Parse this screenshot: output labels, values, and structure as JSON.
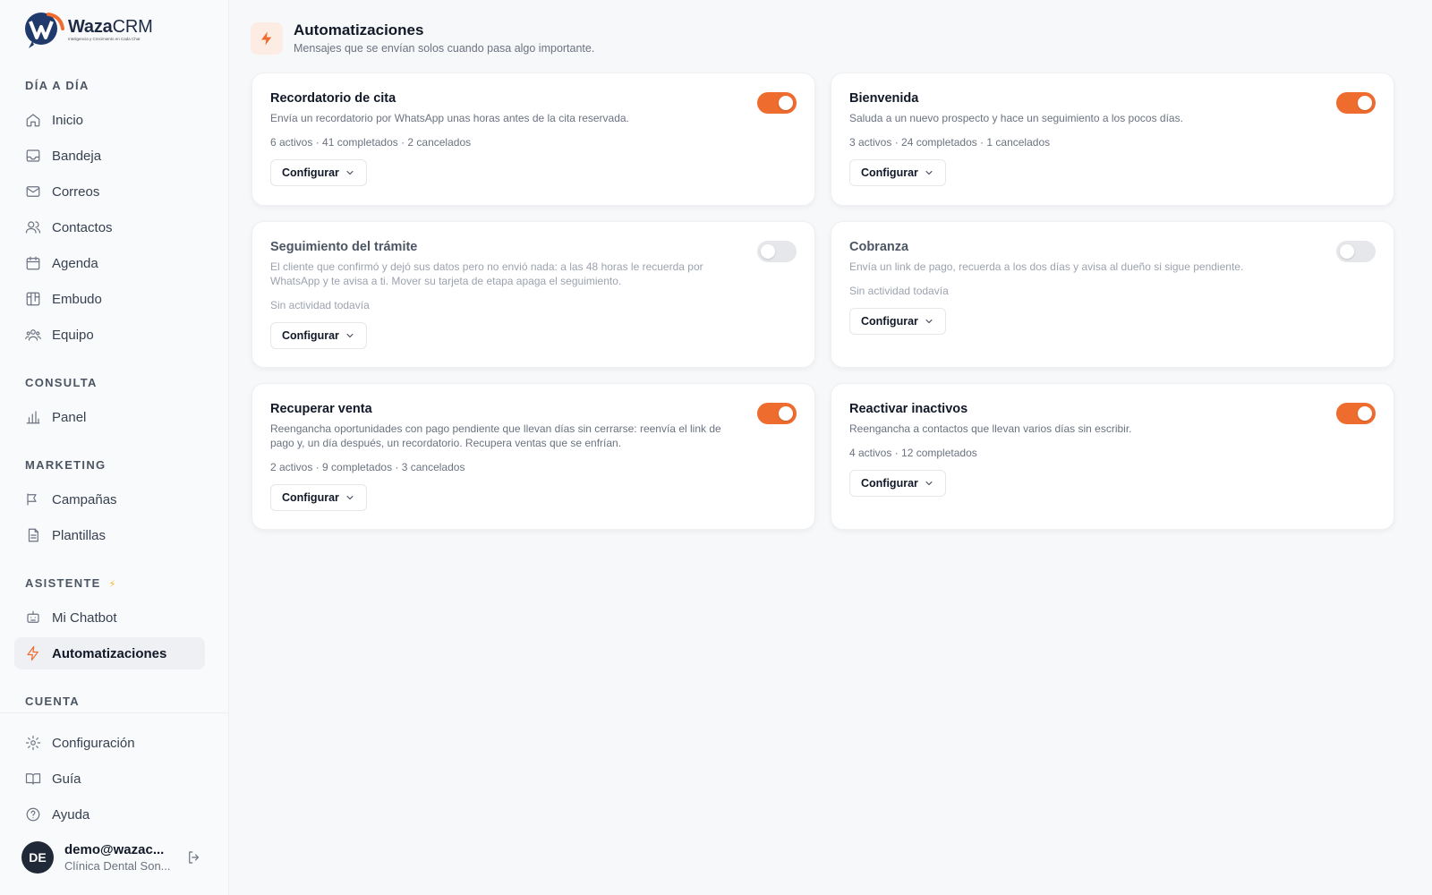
{
  "brand": {
    "name_bold": "Waza",
    "name_light": "CRM",
    "tagline": "Inteligencia y Crecimiento en Cada Chat"
  },
  "sidebar": {
    "sections": [
      {
        "title": "DÍA A DÍA",
        "items": [
          {
            "label": "Inicio",
            "icon": "home-icon"
          },
          {
            "label": "Bandeja",
            "icon": "inbox-icon"
          },
          {
            "label": "Correos",
            "icon": "mail-icon"
          },
          {
            "label": "Contactos",
            "icon": "contacts-icon"
          },
          {
            "label": "Agenda",
            "icon": "calendar-icon"
          },
          {
            "label": "Embudo",
            "icon": "funnel-icon"
          },
          {
            "label": "Equipo",
            "icon": "team-icon"
          }
        ]
      },
      {
        "title": "CONSULTA",
        "items": [
          {
            "label": "Panel",
            "icon": "bar-chart-icon"
          }
        ]
      },
      {
        "title": "MARKETING",
        "items": [
          {
            "label": "Campañas",
            "icon": "megaphone-icon"
          },
          {
            "label": "Plantillas",
            "icon": "file-icon"
          }
        ]
      },
      {
        "title": "ASISTENTE",
        "badge": "⚡",
        "items": [
          {
            "label": "Mi Chatbot",
            "icon": "bot-icon"
          },
          {
            "label": "Automatizaciones",
            "icon": "bolt-icon",
            "active": true
          }
        ]
      },
      {
        "title": "CUENTA",
        "items": [
          {
            "label": "Configuración",
            "icon": "gear-icon"
          },
          {
            "label": "Guía",
            "icon": "book-icon"
          },
          {
            "label": "Ayuda",
            "icon": "help-icon"
          }
        ]
      }
    ],
    "user": {
      "initials": "DE",
      "email": "demo@wazac...",
      "org": "Clínica Dental Son..."
    }
  },
  "header": {
    "title": "Automatizaciones",
    "subtitle": "Mensajes que se envían solos cuando pasa algo importante."
  },
  "cards": [
    {
      "title": "Recordatorio de cita",
      "desc": "Envía un recordatorio por WhatsApp unas horas antes de la cita reservada.",
      "stats": "6 activos · 41 completados · 2 cancelados",
      "enabled": true,
      "button": "Configurar"
    },
    {
      "title": "Bienvenida",
      "desc": "Saluda a un nuevo prospecto y hace un seguimiento a los pocos días.",
      "stats": "3 activos · 24 completados · 1 cancelados",
      "enabled": true,
      "button": "Configurar"
    },
    {
      "title": "Seguimiento del trámite",
      "desc": "El cliente que confirmó y dejó sus datos pero no envió nada: a las 48 horas le recuerda por WhatsApp y te avisa a ti. Mover su tarjeta de etapa apaga el seguimiento.",
      "stats": "Sin actividad todavía",
      "enabled": false,
      "button": "Configurar"
    },
    {
      "title": "Cobranza",
      "desc": "Envía un link de pago, recuerda a los dos días y avisa al dueño si sigue pendiente.",
      "stats": "Sin actividad todavía",
      "enabled": false,
      "button": "Configurar"
    },
    {
      "title": "Recuperar venta",
      "desc": "Reengancha oportunidades con pago pendiente que llevan días sin cerrarse: reenvía el link de pago y, un día después, un recordatorio. Recupera ventas que se enfrían.",
      "stats": "2 activos · 9 completados · 3 cancelados",
      "enabled": true,
      "button": "Configurar"
    },
    {
      "title": "Reactivar inactivos",
      "desc": "Reengancha a contactos que llevan varios días sin escribir.",
      "stats": "4 activos · 12 completados",
      "enabled": true,
      "button": "Configurar"
    }
  ],
  "colors": {
    "accent": "#ef6c2f",
    "toggle_off": "#e5e7eb",
    "background": "#f7f8fa"
  }
}
